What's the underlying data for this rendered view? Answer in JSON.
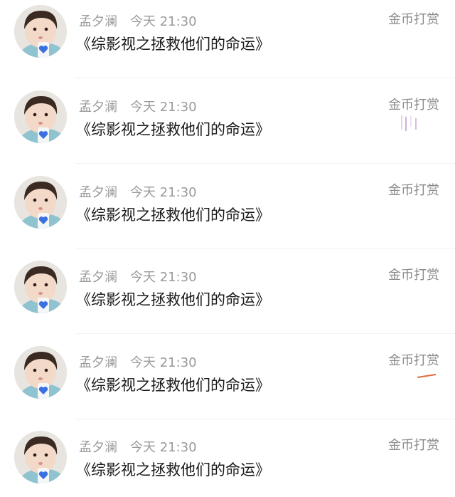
{
  "accent_heart_color": "#3a6fe0",
  "items": [
    {
      "author": "孟夕澜",
      "time": "今天 21:30",
      "title": "《综影视之拯救他们的命运》",
      "reward_label": "金币打赏",
      "avatar_icon": "child-avatar-icon"
    },
    {
      "author": "孟夕澜",
      "time": "今天 21:30",
      "title": "《综影视之拯救他们的命运》",
      "reward_label": "金币打赏",
      "avatar_icon": "child-avatar-icon"
    },
    {
      "author": "孟夕澜",
      "time": "今天 21:30",
      "title": "《综影视之拯救他们的命运》",
      "reward_label": "金币打赏",
      "avatar_icon": "child-avatar-icon"
    },
    {
      "author": "孟夕澜",
      "time": "今天 21:30",
      "title": "《综影视之拯救他们的命运》",
      "reward_label": "金币打赏",
      "avatar_icon": "child-avatar-icon"
    },
    {
      "author": "孟夕澜",
      "time": "今天 21:30",
      "title": "《综影视之拯救他们的命运》",
      "reward_label": "金币打赏",
      "avatar_icon": "child-avatar-icon"
    },
    {
      "author": "孟夕澜",
      "time": "今天 21:30",
      "title": "《综影视之拯救他们的命运》",
      "reward_label": "金币打赏",
      "avatar_icon": "child-avatar-icon"
    }
  ]
}
